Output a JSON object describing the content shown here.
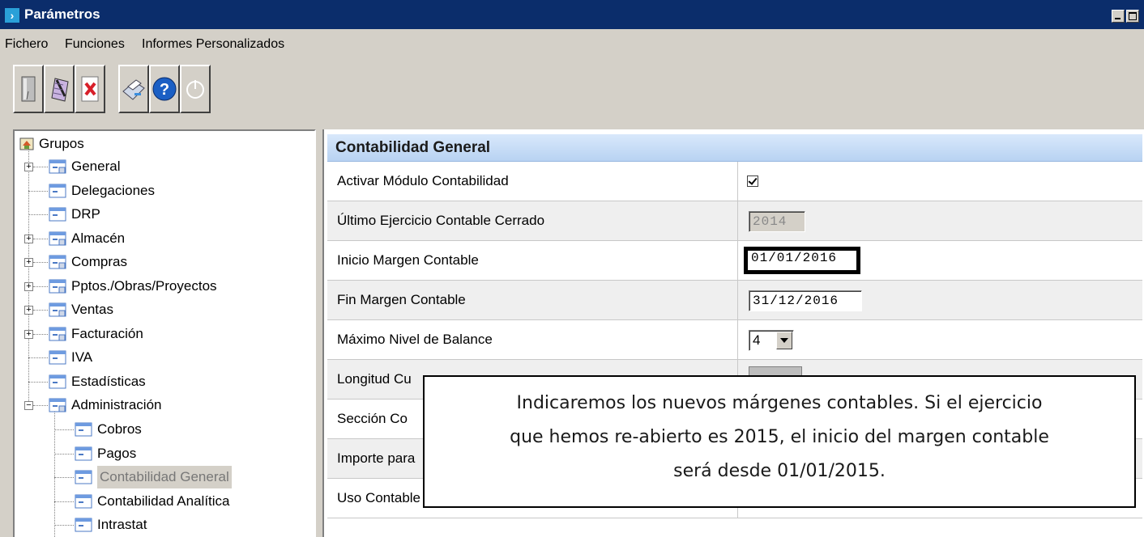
{
  "window": {
    "title": "Parámetros"
  },
  "menu": [
    "Fichero",
    "Funciones",
    "Informes Personalizados"
  ],
  "toolbar": [
    "document-icon",
    "edit-icon",
    "delete-icon",
    "print-icon",
    "help-icon",
    "power-icon"
  ],
  "tree": {
    "root": "Grupos",
    "items": [
      {
        "label": "General",
        "expandable": true
      },
      {
        "label": "Delegaciones",
        "expandable": false
      },
      {
        "label": "DRP",
        "expandable": false
      },
      {
        "label": "Almacén",
        "expandable": true
      },
      {
        "label": "Compras",
        "expandable": true
      },
      {
        "label": "Pptos./Obras/Proyectos",
        "expandable": true
      },
      {
        "label": "Ventas",
        "expandable": true
      },
      {
        "label": "Facturación",
        "expandable": true
      },
      {
        "label": "IVA",
        "expandable": false
      },
      {
        "label": "Estadísticas",
        "expandable": false
      },
      {
        "label": "Administración",
        "expandable": true,
        "expanded": true
      }
    ],
    "children": [
      {
        "label": "Cobros"
      },
      {
        "label": "Pagos"
      },
      {
        "label": "Contabilidad General",
        "selected": true
      },
      {
        "label": "Contabilidad Analítica"
      },
      {
        "label": "Intrastat"
      }
    ]
  },
  "panel": {
    "title": "Contabilidad General",
    "rows": [
      {
        "label": "Activar Módulo Contabilidad",
        "type": "checkbox",
        "checked": true
      },
      {
        "label": "Último Ejercicio Contable Cerrado",
        "type": "text-disabled",
        "value": "2014"
      },
      {
        "label": "Inicio Margen Contable",
        "type": "text-focus",
        "value": "01/01/2016"
      },
      {
        "label": "Fin Margen Contable",
        "type": "text",
        "value": "31/12/2016"
      },
      {
        "label": "Máximo Nivel de Balance",
        "type": "combo",
        "value": "4"
      },
      {
        "label": "Longitud Cu",
        "type": "partial"
      },
      {
        "label": "Sección Co",
        "type": "partial"
      },
      {
        "label": "Importe para",
        "type": "partial"
      },
      {
        "label": "Uso Contable de Retenciones",
        "type": "checkbox",
        "checked": true
      }
    ]
  },
  "callout": {
    "line1": "Indicaremos los nuevos márgenes contables. Si el ejercicio",
    "line2": "que hemos re-abierto es 2015, el inicio del margen contable",
    "line3": "será desde 01/01/2015."
  },
  "colors": {
    "titlebar": "#0b2d6b",
    "header_gradient": "#b8d2f2",
    "selected": "#d4d0c8"
  }
}
